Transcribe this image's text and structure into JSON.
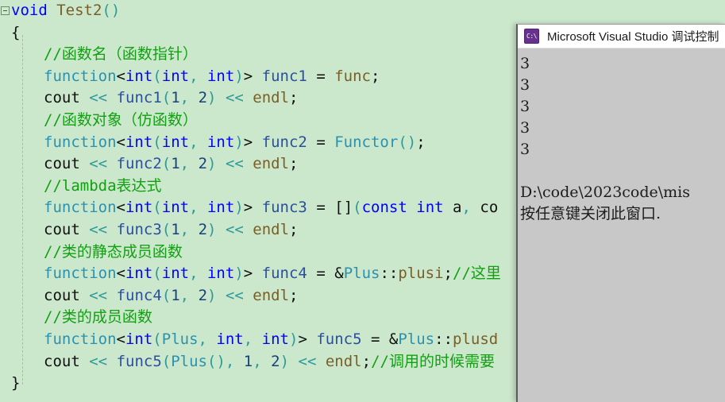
{
  "editor": {
    "name": "visual-studio-code-editor",
    "background_color": "#cce8cc",
    "collapse_marker": "collapsed-region-toggle",
    "lines": [
      {
        "id": "line-1",
        "indent": 0,
        "text": "void Test2()"
      },
      {
        "id": "line-2",
        "indent": 0,
        "text": "{"
      },
      {
        "id": "line-3",
        "indent": 1,
        "text": "//函数名（函数指针）"
      },
      {
        "id": "line-4",
        "indent": 1,
        "text": "function<int(int, int)> func1 = func;"
      },
      {
        "id": "line-5",
        "indent": 1,
        "text": "cout << func1(1, 2) << endl;"
      },
      {
        "id": "line-6",
        "indent": 1,
        "text": "//函数对象（仿函数）"
      },
      {
        "id": "line-7",
        "indent": 1,
        "text": "function<int(int, int)> func2 = Functor();"
      },
      {
        "id": "line-8",
        "indent": 1,
        "text": "cout << func2(1, 2) << endl;"
      },
      {
        "id": "line-9",
        "indent": 1,
        "text": "//lambda表达式"
      },
      {
        "id": "line-10",
        "indent": 1,
        "text": "function<int(int, int)> func3 = [](const int a, co"
      },
      {
        "id": "line-11",
        "indent": 1,
        "text": "cout << func3(1, 2) << endl;"
      },
      {
        "id": "line-12",
        "indent": 1,
        "text": "//类的静态成员函数"
      },
      {
        "id": "line-13",
        "indent": 1,
        "text": "function<int(int, int)> func4 = &Plus::plusi;//这里"
      },
      {
        "id": "line-14",
        "indent": 1,
        "text": "cout << func4(1, 2) << endl;"
      },
      {
        "id": "line-15",
        "indent": 1,
        "text": "//类的成员函数"
      },
      {
        "id": "line-16",
        "indent": 1,
        "text": "function<int(Plus, int, int)> func5 = &Plus::plusd"
      },
      {
        "id": "line-17",
        "indent": 1,
        "text": "cout << func5(Plus(), 1, 2) << endl;//调用的时候需要"
      },
      {
        "id": "line-18",
        "indent": 0,
        "text": "}"
      }
    ],
    "colors": {
      "keyword": "#0000ff",
      "type": "#2b91af",
      "identifier": "#2b4f9e",
      "function": "#795e26",
      "operator": "#2e9a9a",
      "comment": "#12a012",
      "plain": "#101010"
    }
  },
  "console": {
    "name": "visual-studio-debug-console",
    "icon": "console-app-icon",
    "icon_glyph": "C:\\",
    "title": "Microsoft Visual Studio 调试控制",
    "title_full": "Microsoft Visual Studio 调试控制台",
    "background_color": "#c8c8c8",
    "titlebar_color": "#ffffff",
    "output": [
      "3",
      "3",
      "3",
      "3",
      "3",
      "",
      "D:\\code\\2023code\\mis",
      "按任意键关闭此窗口."
    ]
  }
}
